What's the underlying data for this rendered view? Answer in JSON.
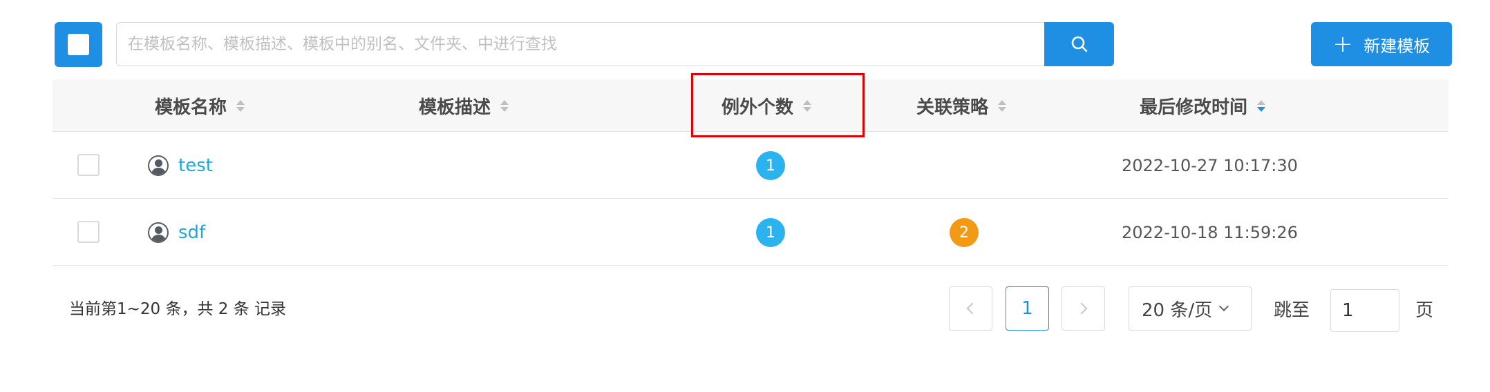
{
  "toolbar": {
    "search_placeholder": "在模板名称、模板描述、模板中的别名、文件夹、中进行查找",
    "search_value": "",
    "new_template_label": "新建模板"
  },
  "table": {
    "columns": [
      {
        "label": "模板名称",
        "sort": "none"
      },
      {
        "label": "模板描述",
        "sort": "none"
      },
      {
        "label": "例外个数",
        "sort": "none"
      },
      {
        "label": "关联策略",
        "sort": "none"
      },
      {
        "label": "最后修改时间",
        "sort": "desc"
      }
    ],
    "rows": [
      {
        "name": "test",
        "description": "",
        "exceptions": "1",
        "policies": "",
        "modified": "2022-10-27 10:17:30"
      },
      {
        "name": "sdf",
        "description": "",
        "exceptions": "1",
        "policies": "2",
        "modified": "2022-10-18 11:59:26"
      }
    ]
  },
  "pagination": {
    "record_info": "当前第1~20 条，共 2 条 记录",
    "current_page": "1",
    "page_size_label": "20 条/页",
    "jump_label": "跳至",
    "jump_value": "1",
    "page_suffix": "页"
  },
  "colors": {
    "primary": "#1e8fe3",
    "link": "#1ca8dd",
    "badge_blue": "#2ab3ef",
    "badge_orange": "#f29a16",
    "highlight": "#e30000"
  }
}
